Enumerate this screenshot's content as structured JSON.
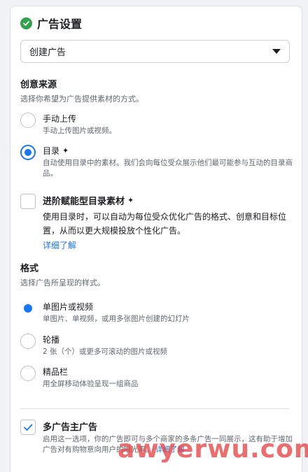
{
  "header": {
    "title": "广告设置"
  },
  "ad_type_select": {
    "value": "创建广告"
  },
  "creative_source": {
    "title": "创意来源",
    "desc": "选择你希望为广告提供素材的方式。",
    "options": [
      {
        "title": "手动上传",
        "desc": "手动上传图片或视频。"
      },
      {
        "title": "目录",
        "desc": "自动使用目录中的素材。我们会向每位受众展示他们最可能参与互动的目录商品。"
      }
    ],
    "advantage": {
      "title": "进阶赋能型目录素材",
      "desc": "使用目录时，可以自动为每位受众优化广告的格式、创意和目标位置，从而以更大规模投放个性化广告。",
      "link": "详细了解"
    }
  },
  "format": {
    "title": "格式",
    "desc": "选择广告所呈现的样式。",
    "options": [
      {
        "title": "单图片或视频",
        "desc": "单图片、单视频，或用多张图片创建的幻灯片"
      },
      {
        "title": "轮播",
        "desc": "2 张（个）或更多可滚动的图片或视频"
      },
      {
        "title": "精品栏",
        "desc": "用全屏移动体验呈现一组商品"
      }
    ]
  },
  "multi_advertiser": {
    "title": "多广告主广告",
    "desc": "启用这一选项，你的广告即可与多个商家的多条广告一同展示，这有助于增加广告对有购物意向用户的眼光率。",
    "link": "详细了解"
  },
  "watermark": "awyerwu.com",
  "colors": {
    "accent": "#1877f2",
    "success": "#31a24c"
  }
}
